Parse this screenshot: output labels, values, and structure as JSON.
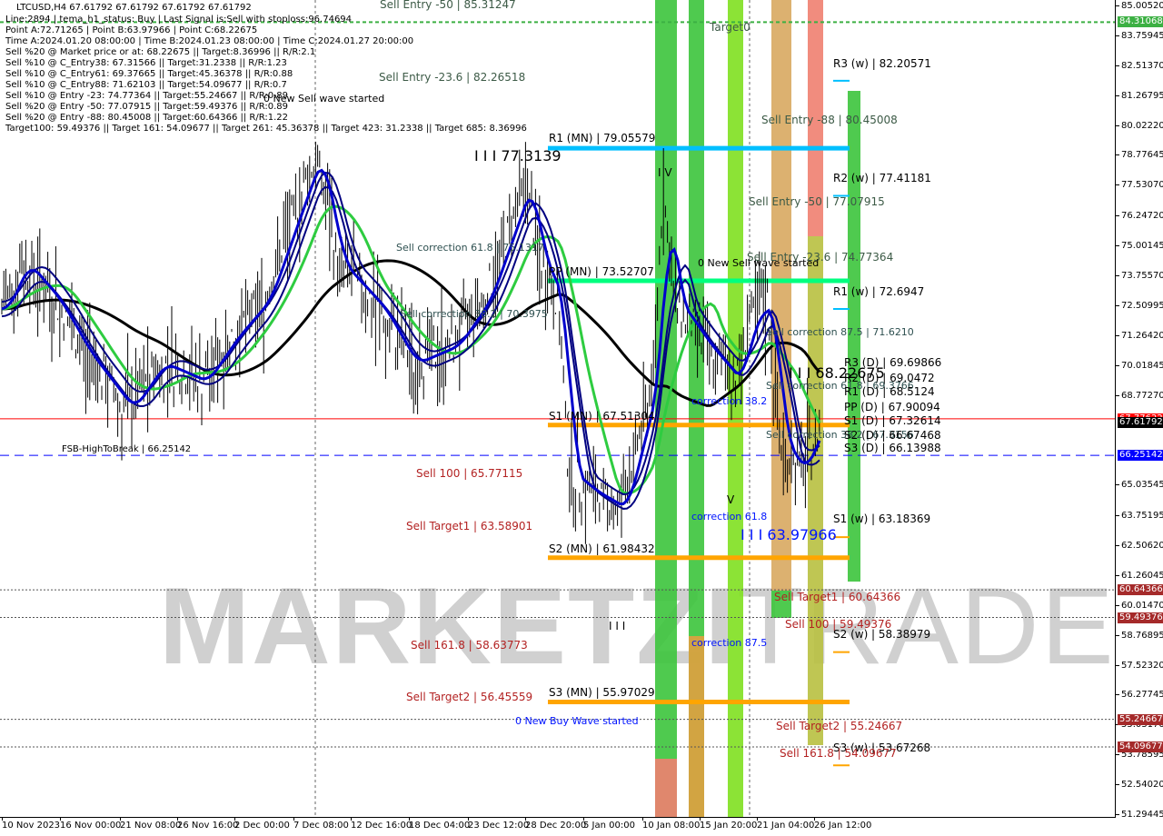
{
  "header": {
    "symbol_line": "LTCUSD,H4  67.61792 67.61792 67.61792 67.61792",
    "info_lines": [
      "Line:2894 | tema_h1_status: Buy | Last Signal is:Sell with stoploss:96.74694",
      "Point A:72.71265 | Point B:63.97966 | Point C:68.22675",
      "Time A:2024.01.20 08:00:00 | Time B:2024.01.23 08:00:00 | Time C:2024.01.27 20:00:00",
      "Sell %20 @ Market price or at: 68.22675 || Target:8.36996 || R/R:2.1",
      "Sell %10 @ C_Entry38: 67.31566 || Target:31.2338 || R/R:1.23",
      "Sell %10 @ C_Entry61: 69.37665 || Target:45.36378 || R/R:0.88",
      "Sell %10 @ C_Entry88: 71.62103 || Target:54.09677 || R/R:0.7",
      "Sell %10 @ Entry -23: 74.77364 || Target:55.24667 || R/R:0.89",
      "Sell %20 @ Entry -50: 77.07915 || Target:59.49376 || R/R:0.89",
      "Sell %20 @ Entry -88: 80.45008 || Target:60.64366 || R/R:1.22",
      "Target100: 59.49376 || Target 161: 54.09677 || Target 261: 45.36378 || Target 423: 31.2338 || Target 685: 8.36996"
    ]
  },
  "watermark": {
    "bold": "MARKETZI",
    "thin": "TRADE"
  },
  "labels": [
    "Sell Entry -50 | 85.31247",
    "Sell Entry -23.6 | 82.26518",
    "0 New Sell wave started",
    "I I I 77.3139",
    "R1 (MN) | 79.05579",
    "Sell correction 61.8 | 75.1317",
    "PP (MN) | 73.52707",
    "Sell correction 38.2 | 70.3975",
    "S1 (MN) | 67.51304",
    "FSB-HighToBreak | 66.25142",
    "Sell 100 | 65.77115",
    "Sell Target1 | 63.58901",
    "S2 (MN) | 61.98432",
    "I I I",
    "Sell 161.8 | 58.63773",
    "Sell Target2 | 56.45559",
    "S3 (MN) | 55.97029",
    "0 New Buy Wave started",
    "Target0",
    "I V",
    "Sell Entry -88 | 80.45008",
    "R3 (w) | 82.20571",
    "R2 (w) | 77.41181",
    "Sell Entry -50 | 77.07915",
    "Sell Entry -23.6 | 74.77364",
    "0 New Sell wave started",
    "R1 (w) | 72.6947",
    "Sell correction 87.5 | 71.6210",
    "R3 (D) | 69.69866",
    "I I I 68.22675",
    "R2 (D) | 69.0472",
    "Sell correction 61.8 | 69.3766",
    "R1 (D) | 68.5124",
    "correction 38.2",
    "PP (D) | 67.90094",
    "S1 (D) | 67.32614",
    "Sell correction 38.2 | 67.3156",
    "S2 (D) | 66.67468",
    "S3 (D) | 66.13988",
    "V",
    "correction 61.8",
    "I I I 63.97966",
    "S1 (w) | 63.18369",
    "Sell Target1 | 60.64366",
    "Sell 100 | 59.49376",
    "S2 (w) | 58.38979",
    "correction 87.5",
    "Sell Target2 | 55.24667",
    "S3 (w) | 53.67268",
    "Sell 161.8 | 54.09677"
  ],
  "price_axis": {
    "ticks": [
      "85.00520",
      "83.75945",
      "82.51370",
      "81.26795",
      "80.02220",
      "78.77645",
      "77.53070",
      "76.24720",
      "75.00145",
      "73.75570",
      "72.50995",
      "71.26420",
      "70.01845",
      "68.77270",
      "65.03545",
      "63.75195",
      "62.50620",
      "61.26045",
      "60.01470",
      "58.76895",
      "57.52320",
      "56.27745",
      "55.03170",
      "53.78595",
      "52.54020",
      "51.29445"
    ],
    "tags": [
      {
        "text": "84.31068",
        "color": "#3cb043"
      },
      {
        "text": "67.77622",
        "color": "#ff0000"
      },
      {
        "text": "67.61792",
        "color": "#000000"
      },
      {
        "text": "66.25142",
        "color": "#0000ff"
      },
      {
        "text": "60.64366",
        "color": "#a52a2a"
      },
      {
        "text": "59.49376",
        "color": "#a52a2a"
      },
      {
        "text": "55.24667",
        "color": "#a52a2a"
      },
      {
        "text": "54.09677",
        "color": "#a52a2a"
      }
    ]
  },
  "time_axis": [
    "10 Nov 2023",
    "16 Nov 00:00",
    "21 Nov 08:00",
    "26 Nov 16:00",
    "2 Dec 00:00",
    "7 Dec 08:00",
    "12 Dec 16:00",
    "18 Dec 04:00",
    "23 Dec 12:00",
    "28 Dec 20:00",
    "5 Jan 00:00",
    "10 Jan 08:00",
    "15 Jan 20:00",
    "21 Jan 04:00",
    "26 Jan 12:00"
  ],
  "chart_data": {
    "type": "line",
    "title": "LTCUSD,H4",
    "ylim": [
      51.29445,
      85.0052
    ],
    "xlim": [
      "2023-11-10",
      "2024-01-28"
    ],
    "grid": false,
    "series": [
      {
        "x": [
          "2023-11-10",
          "2023-11-12",
          "2023-11-15",
          "2023-11-18",
          "2023-11-22",
          "2023-11-25",
          "2023-11-29",
          "2023-12-02",
          "2023-12-05",
          "2023-12-09",
          "2023-12-10",
          "2023-12-12",
          "2023-12-16",
          "2023-12-19",
          "2023-12-23",
          "2023-12-26",
          "2023-12-30",
          "2023-12-31",
          "2024-01-02",
          "2024-01-03",
          "2024-01-05",
          "2024-01-08",
          "2024-01-11",
          "2024-01-12",
          "2024-01-13",
          "2024-01-16",
          "2024-01-19",
          "2024-01-20",
          "2024-01-22",
          "2024-01-23",
          "2024-01-25",
          "2024-01-26",
          "2024-01-27"
        ],
        "y": [
          72.35,
          74.25,
          72.73,
          70.46,
          68.19,
          70.08,
          69.32,
          71.22,
          72.73,
          77.66,
          78.79,
          74.25,
          72.35,
          70.08,
          70.84,
          72.73,
          77.66,
          74.63,
          72.73,
          65.54,
          64.78,
          64.02,
          69.32,
          77.28,
          72.73,
          70.84,
          69.32,
          71.6,
          72.73,
          67.05,
          65.54,
          66.67,
          67.62
        ]
      }
    ],
    "levels": [
      {
        "name": "R1 (MN)",
        "value": 79.05579,
        "color": "#00bfff"
      },
      {
        "name": "PP (MN)",
        "value": 73.52707,
        "color": "#00ff7f"
      },
      {
        "name": "S1 (MN)",
        "value": 67.51304,
        "color": "#ffa500"
      },
      {
        "name": "S2 (MN)",
        "value": 61.98432,
        "color": "#ffa500"
      },
      {
        "name": "S3 (MN)",
        "value": 55.97029,
        "color": "#ffa500"
      },
      {
        "name": "FSB-HighToBreak",
        "value": 66.25142,
        "color": "#0000ff"
      },
      {
        "name": "bid",
        "value": 67.77622,
        "color": "#ff0000"
      }
    ]
  }
}
